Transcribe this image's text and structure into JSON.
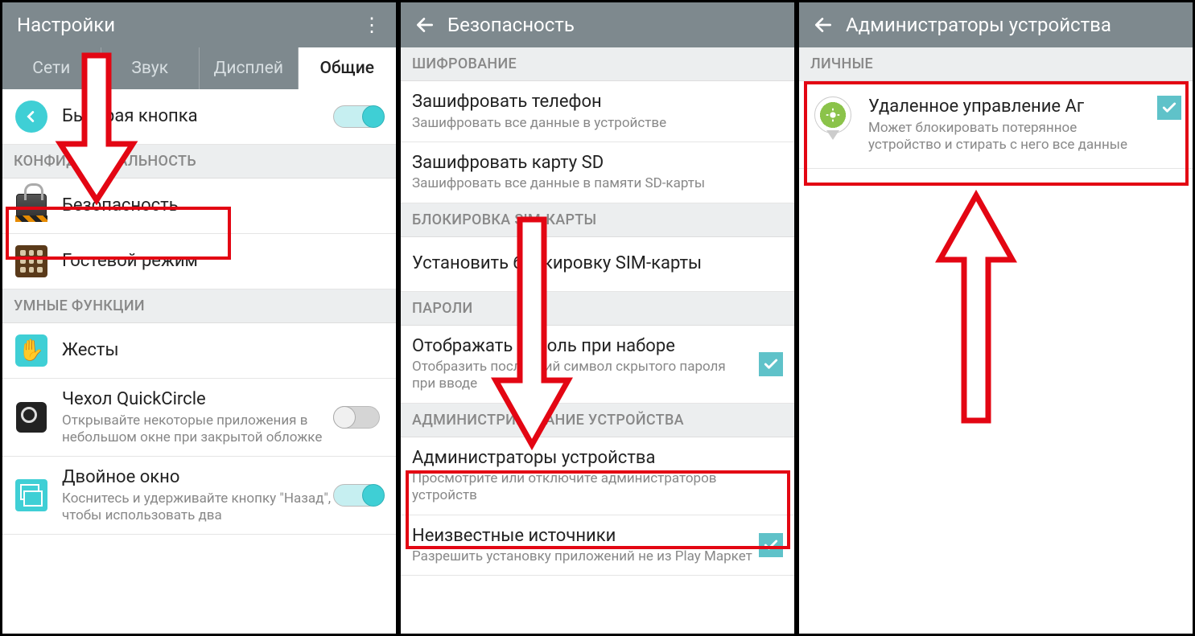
{
  "panel1": {
    "header_title": "Настройки",
    "tabs": [
      "Сети",
      "Звук",
      "Дисплей",
      "Общие"
    ],
    "quick_button": "Быстрая кнопка",
    "section_privacy": "КОНФИДЕНЦИАЛЬНОСТЬ",
    "security": "Безопасность",
    "guest_mode": "Гостевой режим",
    "section_smart": "УМНЫЕ ФУНКЦИИ",
    "gestures": "Жесты",
    "quickcircle_title": "Чехол QuickCircle",
    "quickcircle_sub": "Открывайте некоторые приложения в небольшом окне при закрытой обложке",
    "dual_title": "Двойное окно",
    "dual_sub": "Коснитесь и удерживайте кнопку \"Назад\", чтобы использовать два"
  },
  "panel2": {
    "header_title": "Безопасность",
    "section_enc": "ШИФРОВАНИЕ",
    "enc_phone_title": "Зашифровать телефон",
    "enc_phone_sub": "Зашифровать все данные в устройстве",
    "enc_sd_title": "Зашифровать карту SD",
    "enc_sd_sub": "Зашифровать все данные в памяти SD-карты",
    "section_sim": "БЛОКИРОВКА SIM-КАРТЫ",
    "sim_lock": "Установить блокировку SIM-карты",
    "section_pass": "ПАРОЛИ",
    "show_pass_title": "Отображать пароль при наборе",
    "show_pass_sub": "Отобразить последний символ скрытого пароля при вводе",
    "section_admin": "АДМИНИСТРИРОВАНИЕ УСТРОЙСТВА",
    "admins_title": "Администраторы устройства",
    "admins_sub": "Просмотрите или отключите администраторов устройств",
    "unknown_title": "Неизвестные источники",
    "unknown_sub": "Разрешить установку приложений не из Play Маркет"
  },
  "panel3": {
    "header_title": "Администраторы устройства",
    "section_personal": "ЛИЧНЫЕ",
    "remote_title": "Удаленное управление Aг",
    "remote_sub": "Может блокировать потерянное устройство и стирать с него все данные"
  }
}
